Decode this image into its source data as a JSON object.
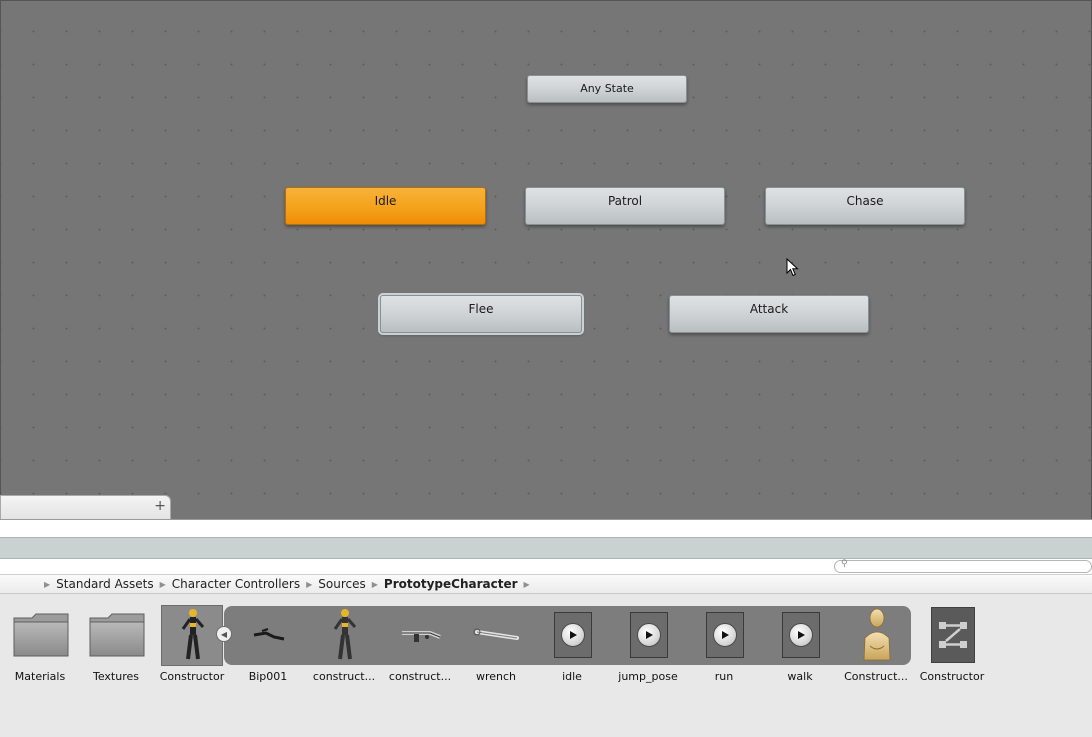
{
  "states": {
    "any_state": "Any State",
    "idle": "Idle",
    "patrol": "Patrol",
    "chase": "Chase",
    "flee": "Flee",
    "attack": "Attack"
  },
  "layers_tab": {
    "add_label": "+"
  },
  "breadcrumb": [
    "Standard Assets",
    "Character Controllers",
    "Sources",
    "PrototypeCharacter"
  ],
  "assets": [
    {
      "label": "Materials",
      "icon": "folder-icon"
    },
    {
      "label": "Textures",
      "icon": "folder-icon"
    },
    {
      "label": "Constructor",
      "icon": "model-prefab-icon"
    },
    {
      "label": "Bip001",
      "icon": "mesh-icon"
    },
    {
      "label": "construct...",
      "icon": "mesh-figure-icon"
    },
    {
      "label": "construct...",
      "icon": "mesh-icon"
    },
    {
      "label": "wrench",
      "icon": "wrench-mesh-icon"
    },
    {
      "label": "idle",
      "icon": "animation-clip-icon"
    },
    {
      "label": "jump_pose",
      "icon": "animation-clip-icon"
    },
    {
      "label": "run",
      "icon": "animation-clip-icon"
    },
    {
      "label": "walk",
      "icon": "animation-clip-icon"
    },
    {
      "label": "Construct...",
      "icon": "avatar-icon"
    },
    {
      "label": "Constructor",
      "icon": "animator-controller-icon"
    }
  ],
  "colors": {
    "graph_bg": "#767676",
    "default_state": "#f4a21b",
    "state": "#cfd3d5"
  }
}
